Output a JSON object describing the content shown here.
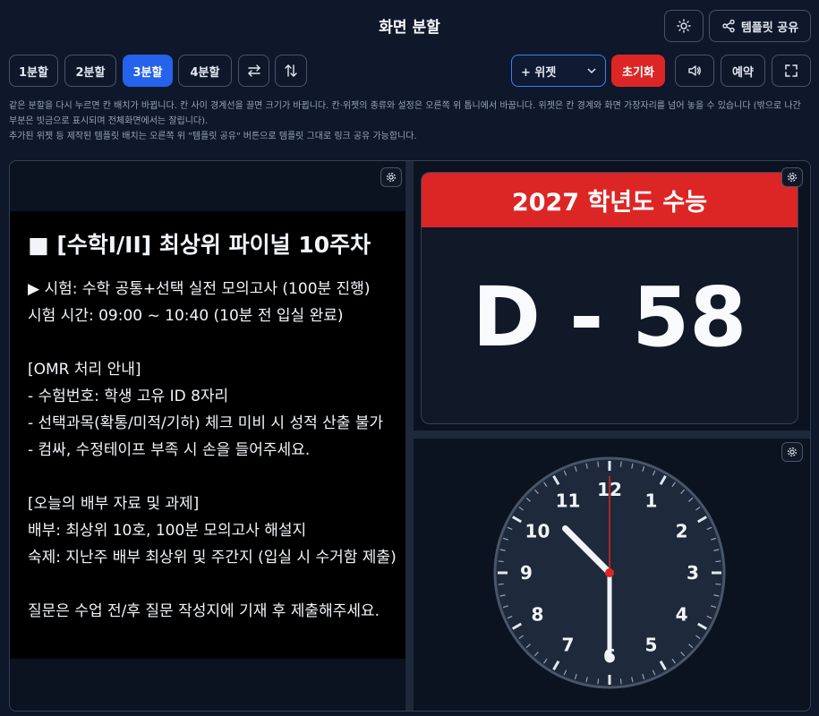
{
  "header": {
    "title": "화면 분할",
    "share_label": "템플릿 공유"
  },
  "toolbar": {
    "split_buttons": [
      "1분할",
      "2분할",
      "3분할",
      "4분할"
    ],
    "active_split": "3분할",
    "widget_select": "+ 위젯",
    "reset_label": "초기화",
    "schedule_label": "예약"
  },
  "description": {
    "line1": "같은 분할을 다시 누르면 칸 배치가 바뀝니다. 칸 사이 경계선을 끌면 크기가 바뀝니다. 칸·위젯의 종류와 설정은 오른쪽 위 톱니에서 바꿉니다. 위젯은 칸 경계와 화면 가장자리를 넘어 놓을 수 있습니다 (밖으로 나간 부분은 빗금으로 표시되며 전체화면에서는 잘립니다).",
    "line2": "추가된 위젯 등 제작된 템플릿 배치는 오른쪽 위 \"템플릿 공유\" 버튼으로 템플릿 그대로 링크 공유 가능합니다."
  },
  "notice": {
    "heading": "■ [수학I/II] 최상위 파이널 10주차",
    "lines": [
      "▶ 시험: 수학 공통+선택 실전 모의고사 (100분 진행)",
      "시험 시간: 09:00 ~ 10:40 (10분 전 입실 완료)",
      "",
      "[OMR 처리 안내]",
      "- 수험번호: 학생 고유 ID 8자리",
      "- 선택과목(확통/미적/기하) 체크 미비 시 성적 산출 불가",
      "- 컴싸, 수정테이프 부족 시 손을 들어주세요.",
      "",
      "[오늘의 배부 자료 및 과제]",
      "배부: 최상위 10호, 100분 모의고사 해설지",
      "숙제: 지난주 배부 최상위 및 주간지 (입실 시 수거함 제출)",
      "",
      "질문은 수업 전/후 질문 작성지에 기재 후 제출해주세요."
    ]
  },
  "dday": {
    "title": "2027 학년도 수능",
    "value": "D - 58"
  },
  "clock": {
    "numbers": [
      "12",
      "1",
      "2",
      "3",
      "4",
      "5",
      "6",
      "7",
      "8",
      "9",
      "10",
      "11"
    ],
    "hour": 10,
    "minute": 30,
    "second": 0,
    "accent_color": "#dc2626"
  },
  "colors": {
    "background": "#0f172a",
    "accent": "#2563eb",
    "danger": "#dc2626"
  }
}
